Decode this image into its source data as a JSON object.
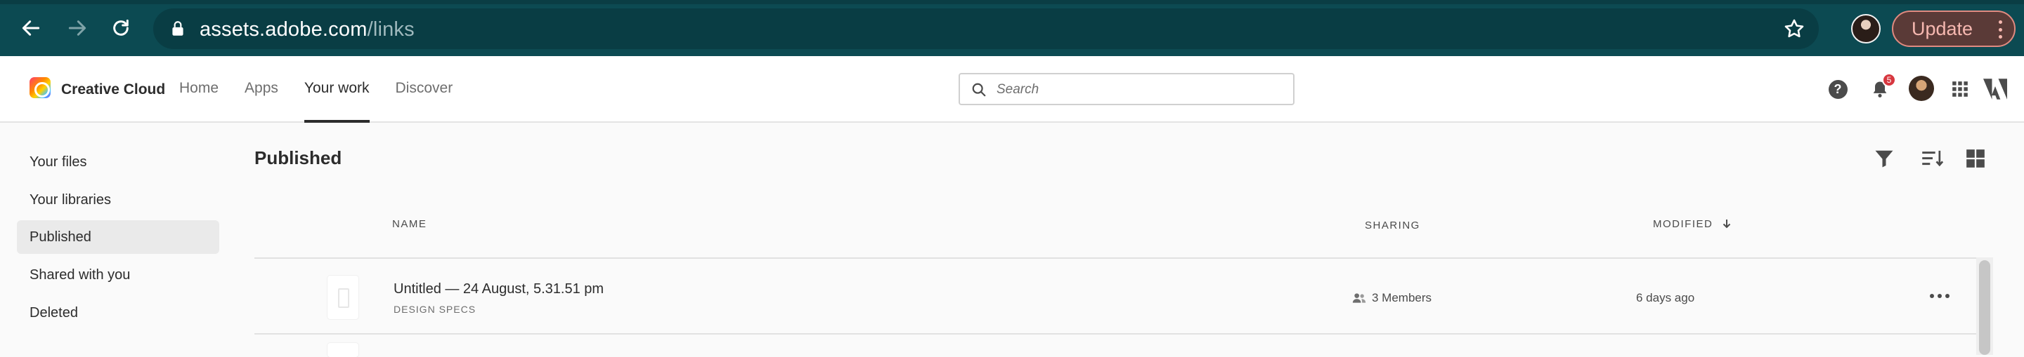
{
  "browser": {
    "url_domain": "assets.adobe.com",
    "url_path": "/links",
    "update_label": "Update"
  },
  "app": {
    "brand": "Creative Cloud",
    "nav": [
      {
        "label": "Home"
      },
      {
        "label": "Apps"
      },
      {
        "label": "Your work",
        "active": true
      },
      {
        "label": "Discover"
      }
    ],
    "search_placeholder": "Search",
    "notifications_count": "5",
    "help_label": "?"
  },
  "sidebar": {
    "items": [
      {
        "label": "Your files"
      },
      {
        "label": "Your libraries"
      },
      {
        "label": "Published",
        "active": true
      },
      {
        "label": "Shared with you"
      },
      {
        "label": "Deleted"
      }
    ]
  },
  "main": {
    "title": "Published",
    "columns": {
      "name": "NAME",
      "sharing": "SHARING",
      "modified": "MODIFIED"
    },
    "rows": [
      {
        "name": "Untitled — 24 August, 5.31.51 pm",
        "type": "DESIGN SPECS",
        "sharing": "3 Members",
        "modified": "6 days ago"
      }
    ]
  },
  "icons": [
    "back-icon",
    "forward-icon",
    "reload-icon",
    "lock-icon",
    "star-icon",
    "help-icon",
    "bell-icon",
    "apps-grid-icon",
    "adobe-logo-icon",
    "search-icon",
    "filter-icon",
    "sort-icon",
    "grid-view-icon",
    "members-icon",
    "more-icon",
    "sort-arrow-down-icon"
  ],
  "colors": {
    "chrome_bg": "#0c4a52",
    "update_border": "#e08a80",
    "badge": "#d7373f"
  }
}
